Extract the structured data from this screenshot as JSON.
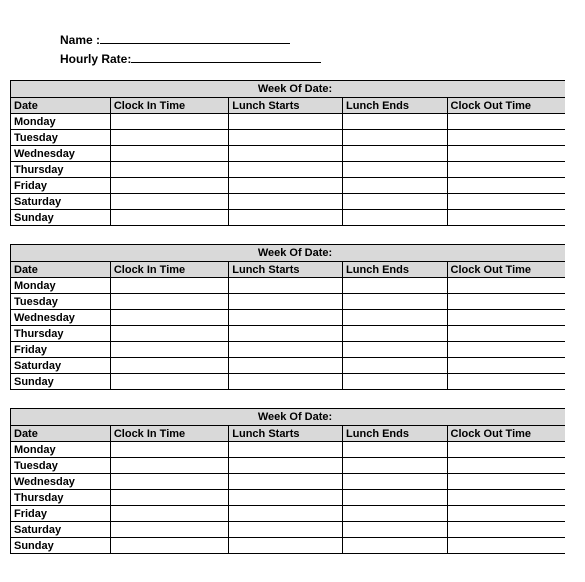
{
  "fields": {
    "name_label": "Name :",
    "rate_label": "Hourly Rate:"
  },
  "week_header": "Week Of Date:",
  "columns": {
    "date": "Date",
    "clock_in": "Clock In Time",
    "lunch_starts": "Lunch Starts",
    "lunch_ends": "Lunch Ends",
    "clock_out": "Clock Out Time"
  },
  "days": [
    "Monday",
    "Tuesday",
    "Wednesday",
    "Thursday",
    "Friday",
    "Saturday",
    "Sunday"
  ],
  "week_count": 3
}
